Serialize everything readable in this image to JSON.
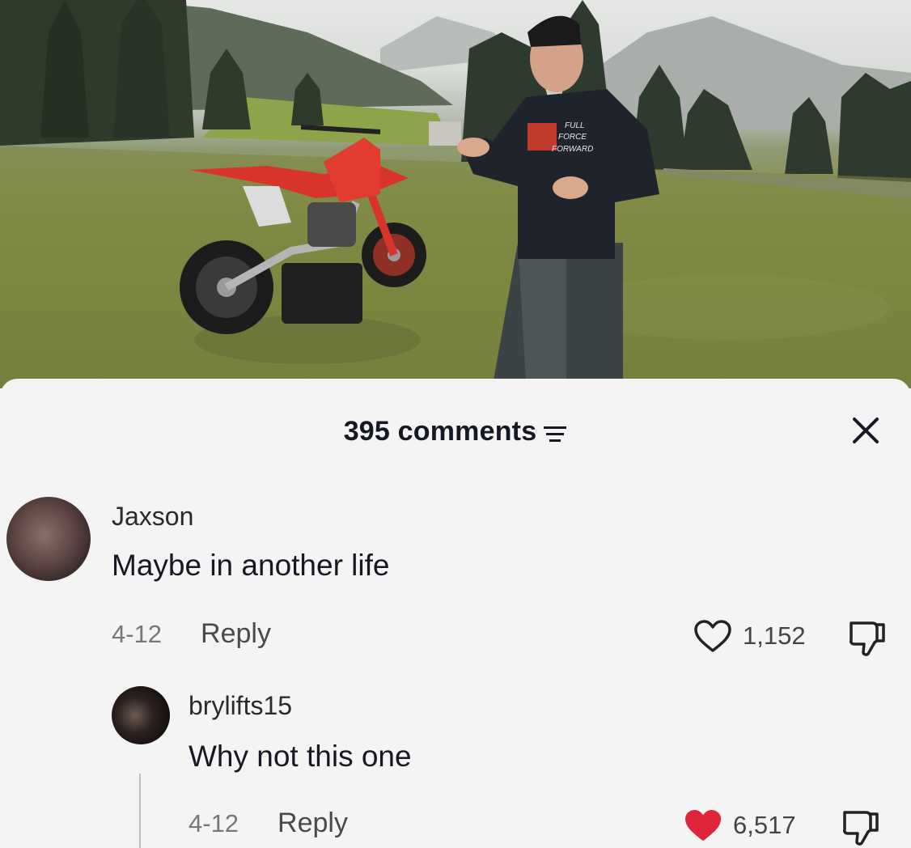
{
  "header": {
    "comment_count": "395 comments"
  },
  "comments": [
    {
      "username": "Jaxson",
      "text": "Maybe in another life",
      "date": "4-12",
      "reply_label": "Reply",
      "likes": "1,152",
      "liked": false
    },
    {
      "username": "brylifts15",
      "text": "Why not this one",
      "date": "4-12",
      "reply_label": "Reply",
      "likes": "6,517",
      "liked": true
    }
  ],
  "hoodie_print": [
    "FULL",
    "FORCE",
    "FORWARD"
  ],
  "colors": {
    "sheet_bg": "#f4f4f4",
    "like_red": "#e0243a",
    "bike_red": "#d9342b",
    "hoodie": "#1f232b"
  },
  "icons": [
    "filter-icon",
    "close-icon",
    "heart-outline-icon",
    "heart-filled-icon",
    "dislike-icon"
  ]
}
